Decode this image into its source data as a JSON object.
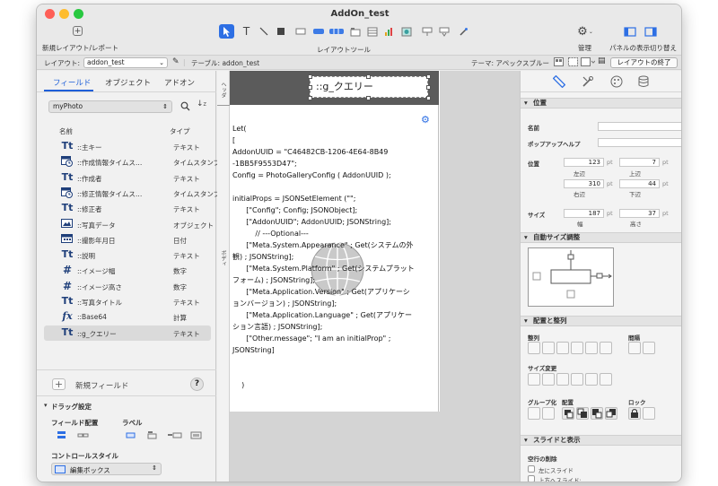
{
  "window": {
    "title": "AddOn_test"
  },
  "toolbar": {
    "new_layout_label": "新規レイアウト/レポート",
    "layout_tools_label": "レイアウトツール",
    "manage_label": "管理",
    "panel_toggle_label": "パネルの表示切り替え"
  },
  "layoutbar": {
    "layout_label": "レイアウト:",
    "layout_value": "addon_test",
    "table_label": "テーブル: addon_test",
    "theme_label": "テーマ: アペックスブルー",
    "exit_layout_button": "レイアウトの終了"
  },
  "left_panel": {
    "tabs": [
      "フィールド",
      "オブジェクト",
      "アドオン"
    ],
    "active_tab": "フィールド",
    "table_select": "myPhoto",
    "columns": {
      "name": "名前",
      "type": "タイプ"
    },
    "fields": [
      {
        "icon": "text",
        "name": "::主キー",
        "type": "テキスト"
      },
      {
        "icon": "timestamp",
        "name": "::作成情報タイムス…",
        "type": "タイムスタンプ"
      },
      {
        "icon": "text",
        "name": "::作成者",
        "type": "テキスト"
      },
      {
        "icon": "timestamp",
        "name": "::修正情報タイムス…",
        "type": "タイムスタンプ"
      },
      {
        "icon": "text",
        "name": "::修正者",
        "type": "テキスト"
      },
      {
        "icon": "container",
        "name": "::写真データ",
        "type": "オブジェクト"
      },
      {
        "icon": "date",
        "name": "::撮影年月日",
        "type": "日付"
      },
      {
        "icon": "text",
        "name": "::説明",
        "type": "テキスト"
      },
      {
        "icon": "number",
        "name": "::イメージ幅",
        "type": "数字"
      },
      {
        "icon": "number",
        "name": "::イメージ高さ",
        "type": "数字"
      },
      {
        "icon": "text",
        "name": "::写真タイトル",
        "type": "テキスト"
      },
      {
        "icon": "calc",
        "name": "::Base64",
        "type": "計算"
      },
      {
        "icon": "text",
        "name": "::g_クエリー",
        "type": "テキスト"
      }
    ],
    "selected_field_index": 12,
    "new_field_label": "新規フィールド",
    "help_label": "?",
    "drag_settings": {
      "title": "ドラッグ設定",
      "field_placement_label": "フィールド配置",
      "label_label": "ラベル",
      "control_style_label": "コントロールスタイル",
      "control_style_value": "編集ボックス"
    }
  },
  "canvas": {
    "header_part_label": "ヘッダ",
    "body_part_label": "ボディ",
    "header_field_text": "::g_クエリー",
    "script_lines": [
      "Let(",
      "[",
      "AddonUUID = \"C46482CB-1206-4E64-8B49",
      "-1BB5F9553D47\";",
      "Config = PhotoGalleryConfig ( AddonUUID );",
      "",
      "initialProps = JSONSetElement (\"\";",
      "      [\"Config\"; Config; JSONObject];",
      "      [\"AddonUUID\"; AddonUUID; JSONString];",
      "          // ---Optional---",
      "      [\"Meta.System.Appearance\" ; Get(システムの外",
      "観) ; JSONString];",
      "      [\"Meta.System.Platform\" ; Get(システムプラット",
      "フォーム) ; JSONString];",
      "      [\"Meta.Application.Version\" ; Get(アプリケーシ",
      "ョンバージョン) ; JSONString];",
      "      [\"Meta.Application.Language\" ; Get(アプリケー",
      "ション言語) ; JSONString];",
      "      [\"Other.message\"; \"I am an initialProp\" ;",
      "JSONString]",
      "",
      "",
      "    )"
    ]
  },
  "inspector": {
    "position_section": "位置",
    "name_label": "名前",
    "popover_help_label": "ポップアップヘルプ",
    "position_label": "位置",
    "left_value": "123",
    "left_label": "左辺",
    "top_value": "7",
    "top_label": "上辺",
    "right_value": "310",
    "right_label": "右辺",
    "bottom_value": "44",
    "bottom_label": "下辺",
    "size_label": "サイズ",
    "width_value": "187",
    "width_label": "幅",
    "height_value": "37",
    "height_label": "高さ",
    "unit": "pt",
    "autosize_section": "自動サイズ調整",
    "arrange_section": "配置と整列",
    "align_label": "整列",
    "spacing_label": "間隔",
    "resize_label": "サイズ変更",
    "group_label": "グループ化",
    "arrange_label": "配置",
    "lock_label": "ロック",
    "slide_section": "スライドと表示",
    "hide_empty_label": "空行の削除",
    "slide_left_label": "左にスライド",
    "slide_up_label": "上方へスライド:"
  }
}
